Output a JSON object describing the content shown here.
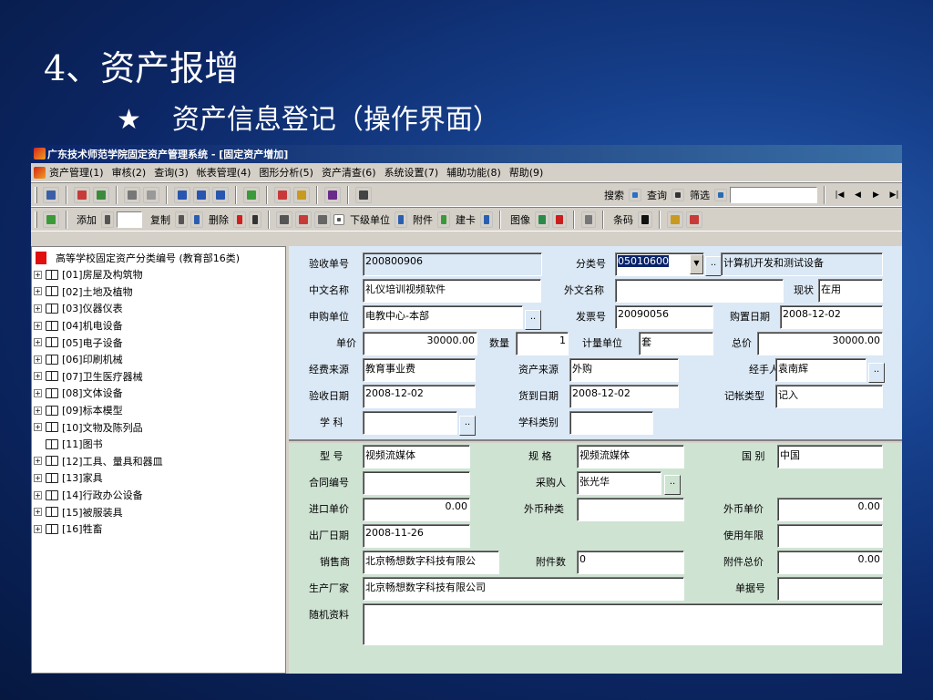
{
  "slide": {
    "title": "4、资产报增",
    "star": "★",
    "subtitle": "资产信息登记（操作界面）"
  },
  "window": {
    "title": "广东技术师范学院固定资产管理系统 - [固定资产增加]"
  },
  "menu": [
    "资产管理(1)",
    "审核(2)",
    "查询(3)",
    "帐表管理(4)",
    "图形分析(5)",
    "资产清查(6)",
    "系统设置(7)",
    "辅助功能(8)",
    "帮助(9)"
  ],
  "toolbar1": {
    "search": "搜索",
    "query": "查询",
    "filter": "筛选",
    "search_value": ""
  },
  "toolbar2": {
    "add": "添加",
    "add_value": "",
    "copy": "复制",
    "delete": "删除",
    "lower_unit": "下级单位",
    "attach": "附件",
    "card": "建卡",
    "image": "图像",
    "barcode": "条码"
  },
  "tree": {
    "root": "高等学校固定资产分类编号 (教育部16类)",
    "items": [
      "[01]房屋及构筑物",
      "[02]土地及植物",
      "[03]仪器仪表",
      "[04]机电设备",
      "[05]电子设备",
      "[06]印刷机械",
      "[07]卫生医疗器械",
      "[08]文体设备",
      "[09]标本模型",
      "[10]文物及陈列品",
      "[11]图书",
      "[12]工具、量具和器皿",
      "[13]家具",
      "[14]行政办公设备",
      "[15]被服装具",
      "[16]牲畜"
    ]
  },
  "form": {
    "labels": {
      "acceptance_no": "验收单号",
      "class_no": "分类号",
      "cn_name": "中文名称",
      "foreign_name": "外文名称",
      "status": "现状",
      "apply_unit": "申购单位",
      "invoice_no": "发票号",
      "purchase_date": "购置日期",
      "unit_price": "单价",
      "quantity": "数量",
      "unit": "计量单位",
      "total_price": "总价",
      "fund_source": "经费来源",
      "asset_source": "资产来源",
      "handler": "经手人",
      "acceptance_date": "验收日期",
      "arrival_date": "货到日期",
      "bookkeeping_type": "记帐类型",
      "subject": "学  科",
      "subject_type": "学科类别",
      "model": "型  号",
      "spec": "规  格",
      "country": "国  别",
      "contract_no": "合同编号",
      "buyer": "采购人",
      "import_price": "进口单价",
      "currency": "外币种类",
      "foreign_price": "外币单价",
      "factory_date": "出厂日期",
      "service_life": "使用年限",
      "seller": "销售商",
      "attachment_count": "附件数",
      "attachment_total": "附件总价",
      "manufacturer": "生产厂家",
      "doc_no": "单据号",
      "accessories": "随机资料"
    },
    "values": {
      "acceptance_no": "200800906",
      "class_no": "05010600",
      "class_name": "计算机开发和测试设备",
      "cn_name": "礼仪培训视频软件",
      "foreign_name": "",
      "status": "在用",
      "apply_unit": "电教中心-本部",
      "invoice_no": "20090056",
      "purchase_date": "2008-12-02",
      "unit_price": "30000.00",
      "quantity": "1",
      "unit": "套",
      "total_price": "30000.00",
      "fund_source": "教育事业费",
      "asset_source": "外购",
      "handler": "袁南辉",
      "acceptance_date": "2008-12-02",
      "arrival_date": "2008-12-02",
      "bookkeeping_type": "记入",
      "subject": "",
      "subject_type": "",
      "model": "视频流媒体",
      "spec": "视频流媒体",
      "country": "中国",
      "contract_no": "",
      "buyer": "张光华",
      "import_price": "0.00",
      "currency": "",
      "foreign_price": "0.00",
      "factory_date": "2008-11-26",
      "service_life": "",
      "seller": "北京畅想数字科技有限公",
      "attachment_count": "0",
      "attachment_total": "0.00",
      "manufacturer": "北京畅想数字科技有限公司",
      "doc_no": "",
      "accessories": ""
    }
  },
  "colors": {
    "title_bar": "#0a246a",
    "top_pane": "#dbe8f5",
    "bottom_pane": "#cfe3d3",
    "selection": "#0a246a"
  }
}
